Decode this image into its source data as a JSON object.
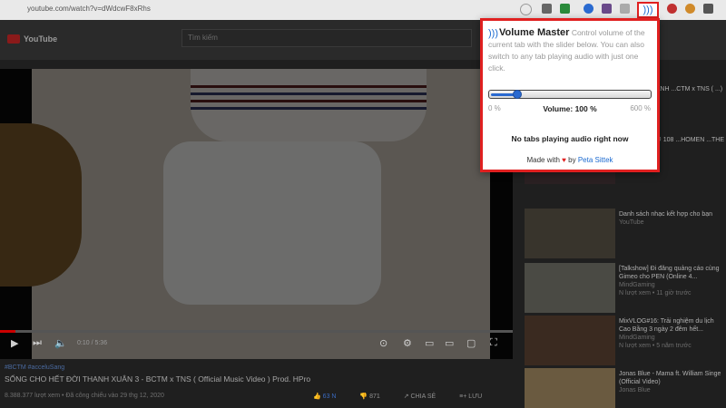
{
  "browser": {
    "url": "youtube.com/watch?v=dWdcwF8xRhs",
    "volume_icon": "volume-waves-icon"
  },
  "youtube": {
    "logo_text": "YouTube",
    "search_placeholder": "Tìm kiếm",
    "video": {
      "time": "0:10 / 5:36",
      "progress_fraction": 0.03,
      "tag": "#BCTM #acceluSang",
      "title": "SỐNG CHO HẾT ĐỜI THANH XUÂN 3 - BCTM x TNS ( Official Music Video ) Prod. HPro",
      "meta": "8.388.377 lượt xem • Đã công chiếu vào 29 thg 12, 2020",
      "likes": "63 N",
      "dislikes": "871",
      "share": "CHIA SẺ",
      "save": "LƯU"
    },
    "sidebar": [
      {
        "title": "...ẾT ĐỜI THANH ...CTM x TNS ( ...)",
        "channel": "...ễ Đình"
      },
      {
        "title": "...ANH LIVE @ 108 ...HOMEN ...THE TOP OF",
        "channel": "...ng xem"
      },
      {
        "title": "Danh sách nhạc kết hợp cho bạn",
        "channel": "YouTube"
      },
      {
        "title": "[Talkshow] Đi đăng quảng cáo cùng Gimeo cho PEN (Online 4...",
        "channel": "MindGaming",
        "stats": "N lượt xem • 11 giờ trước"
      },
      {
        "title": "MixVLOG#16: Trải nghiệm du lịch Cao Bằng 3 ngày 2 đêm hết...",
        "channel": "MindGaming",
        "stats": "N lượt xem • 5 năm trước"
      },
      {
        "title": "Jonas Blue - Mama ft. William Singe (Official Video)",
        "channel": "Jonas Blue"
      }
    ]
  },
  "popup": {
    "title": "Volume Master",
    "description": "Control volume of the current tab with the slider below. You can also switch to any tab playing audio with just one click.",
    "icon": "volume-waves-icon",
    "slider_min_label": "0 %",
    "slider_max_label": "600 %",
    "slider_min": 0,
    "slider_max": 600,
    "volume_percent": 100,
    "volume_label": "Volume: 100 %",
    "no_tabs_text": "No tabs playing audio right now",
    "footer_prefix": "Made with",
    "footer_heart": "♥",
    "footer_by": "by",
    "footer_author": "Peta Sittek"
  }
}
